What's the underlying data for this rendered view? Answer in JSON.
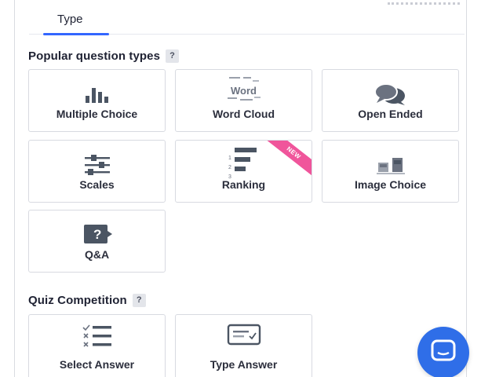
{
  "tab": {
    "label": "Type"
  },
  "sections": {
    "popular": {
      "title": "Popular question types",
      "help": "?"
    },
    "quiz": {
      "title": "Quiz Competition",
      "help": "?"
    }
  },
  "cards": {
    "multiple_choice": {
      "label": "Multiple Choice",
      "icon": "bar-chart-icon"
    },
    "word_cloud": {
      "label": "Word Cloud",
      "icon": "word-cloud-icon",
      "glyph_text": "Word"
    },
    "open_ended": {
      "label": "Open Ended",
      "icon": "speech-bubbles-icon"
    },
    "scales": {
      "label": "Scales",
      "icon": "sliders-icon"
    },
    "ranking": {
      "label": "Ranking",
      "icon": "ranked-list-icon",
      "badge": "NEW",
      "ranks": [
        "1",
        "2",
        "3"
      ]
    },
    "image_choice": {
      "label": "Image Choice",
      "icon": "image-bars-icon"
    },
    "qa": {
      "label": "Q&A",
      "icon": "question-bubble-icon",
      "glyph_text": "?"
    },
    "select_answer": {
      "label": "Select Answer",
      "icon": "checklist-icon"
    },
    "type_answer": {
      "label": "Type Answer",
      "icon": "text-box-icon"
    }
  },
  "colors": {
    "accent": "#3366ff",
    "badge": "#f0559b",
    "fab": "#2f6ee8",
    "icon": "#4b5563"
  }
}
